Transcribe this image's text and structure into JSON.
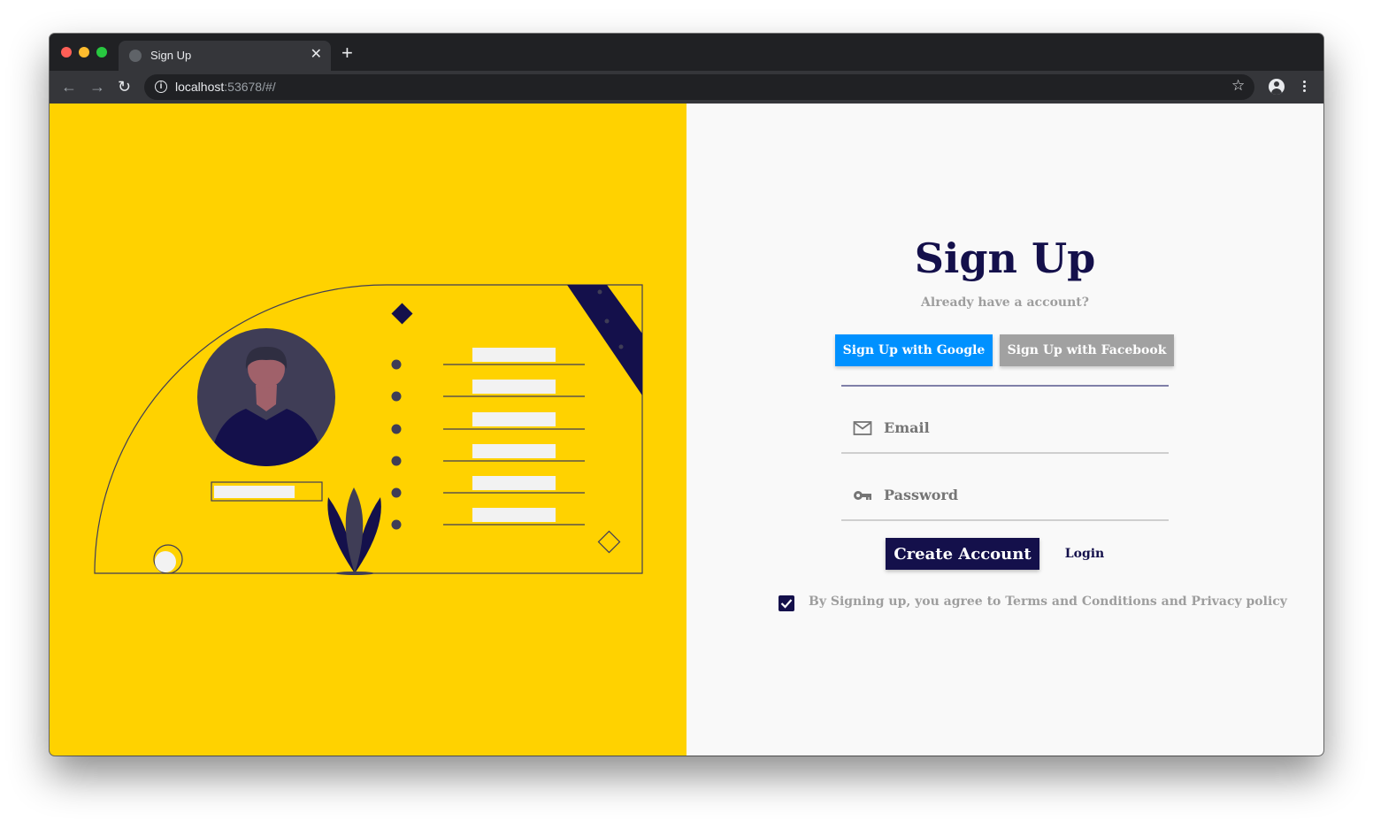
{
  "browser": {
    "tab_title": "Sign Up",
    "tab_close": "✕",
    "new_tab": "+",
    "url_host": "localhost",
    "url_rest": ":53678/#/",
    "back_glyph": "←",
    "forward_glyph": "→",
    "reload_glyph": "↻",
    "star_glyph": "☆",
    "info_glyph": "i"
  },
  "signup": {
    "title": "Sign Up",
    "subtitle": "Already have a account?",
    "google_button": "Sign Up with Google",
    "facebook_button": "Sign Up with Facebook",
    "email_placeholder": "Email",
    "password_placeholder": "Password",
    "create_button": "Create Account",
    "login_link": "Login",
    "terms_checked": true,
    "terms_text": "By Signing up, you agree to Terms and Conditions and Privacy policy"
  },
  "colors": {
    "left_pane_bg": "#ffd200",
    "right_pane_bg": "#f9f9f9",
    "brand_navy": "#14104b",
    "google_blue": "#0091ff",
    "facebook_gray": "#a1a1a1",
    "muted_text": "#9e9e9e"
  },
  "icons": {
    "email_field": "mail-icon",
    "password_field": "key-icon",
    "checkbox": "checkmark-icon"
  }
}
